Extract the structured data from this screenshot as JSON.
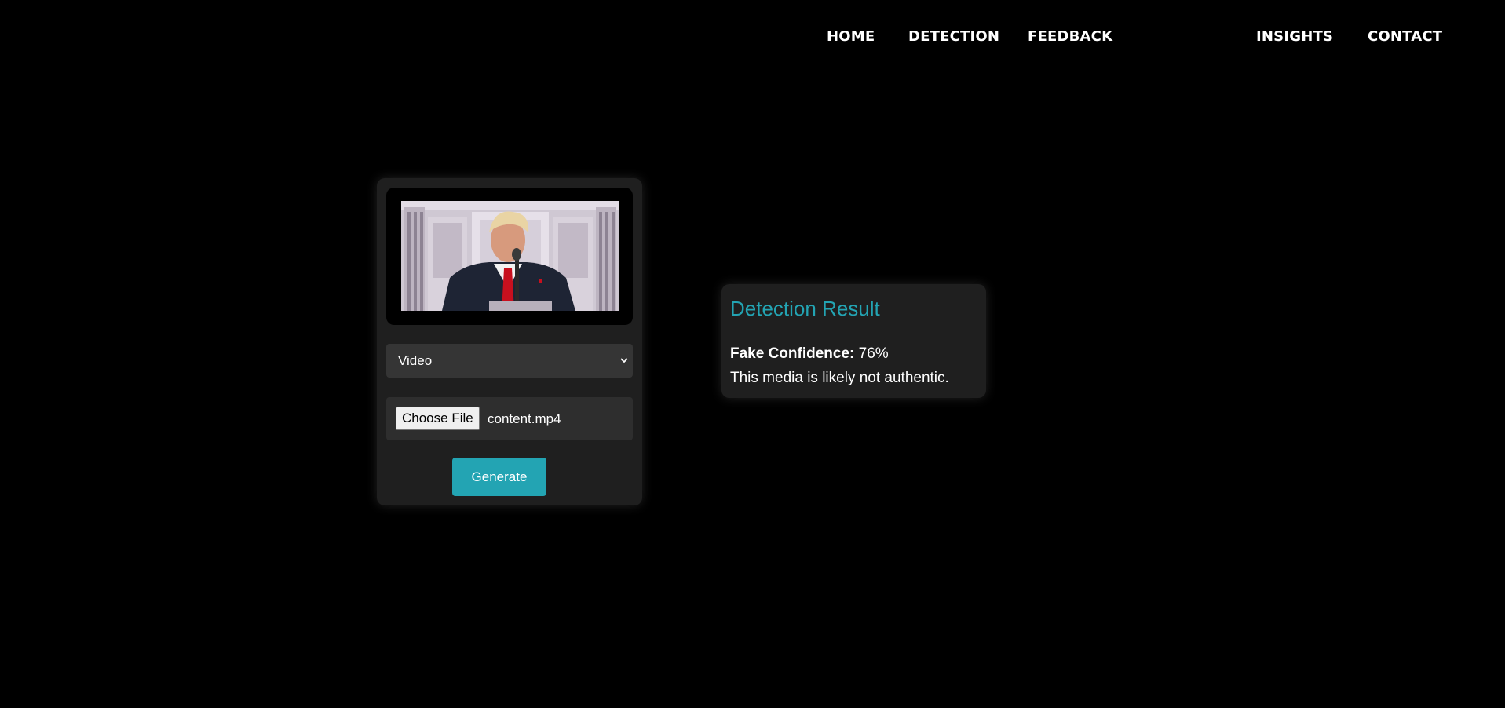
{
  "nav": {
    "items": [
      {
        "label": "HOME"
      },
      {
        "label": "DETECTION"
      },
      {
        "label": "FEEDBACK"
      },
      {
        "label": "INSIGHTS"
      },
      {
        "label": "CONTACT"
      }
    ]
  },
  "upload": {
    "preview_icon": "video-thumbnail",
    "media_type": {
      "selected": "Video"
    },
    "file": {
      "button_label": "Choose File",
      "file_name": "content.mp4"
    },
    "generate_label": "Generate"
  },
  "result": {
    "title": "Detection Result",
    "confidence_label": "Fake Confidence:",
    "confidence_value": "76%",
    "message": "This media is likely not authentic."
  },
  "colors": {
    "background": "#000000",
    "panel": "#1f1f1f",
    "accent": "#23a4b3",
    "text": "#ffffff"
  }
}
